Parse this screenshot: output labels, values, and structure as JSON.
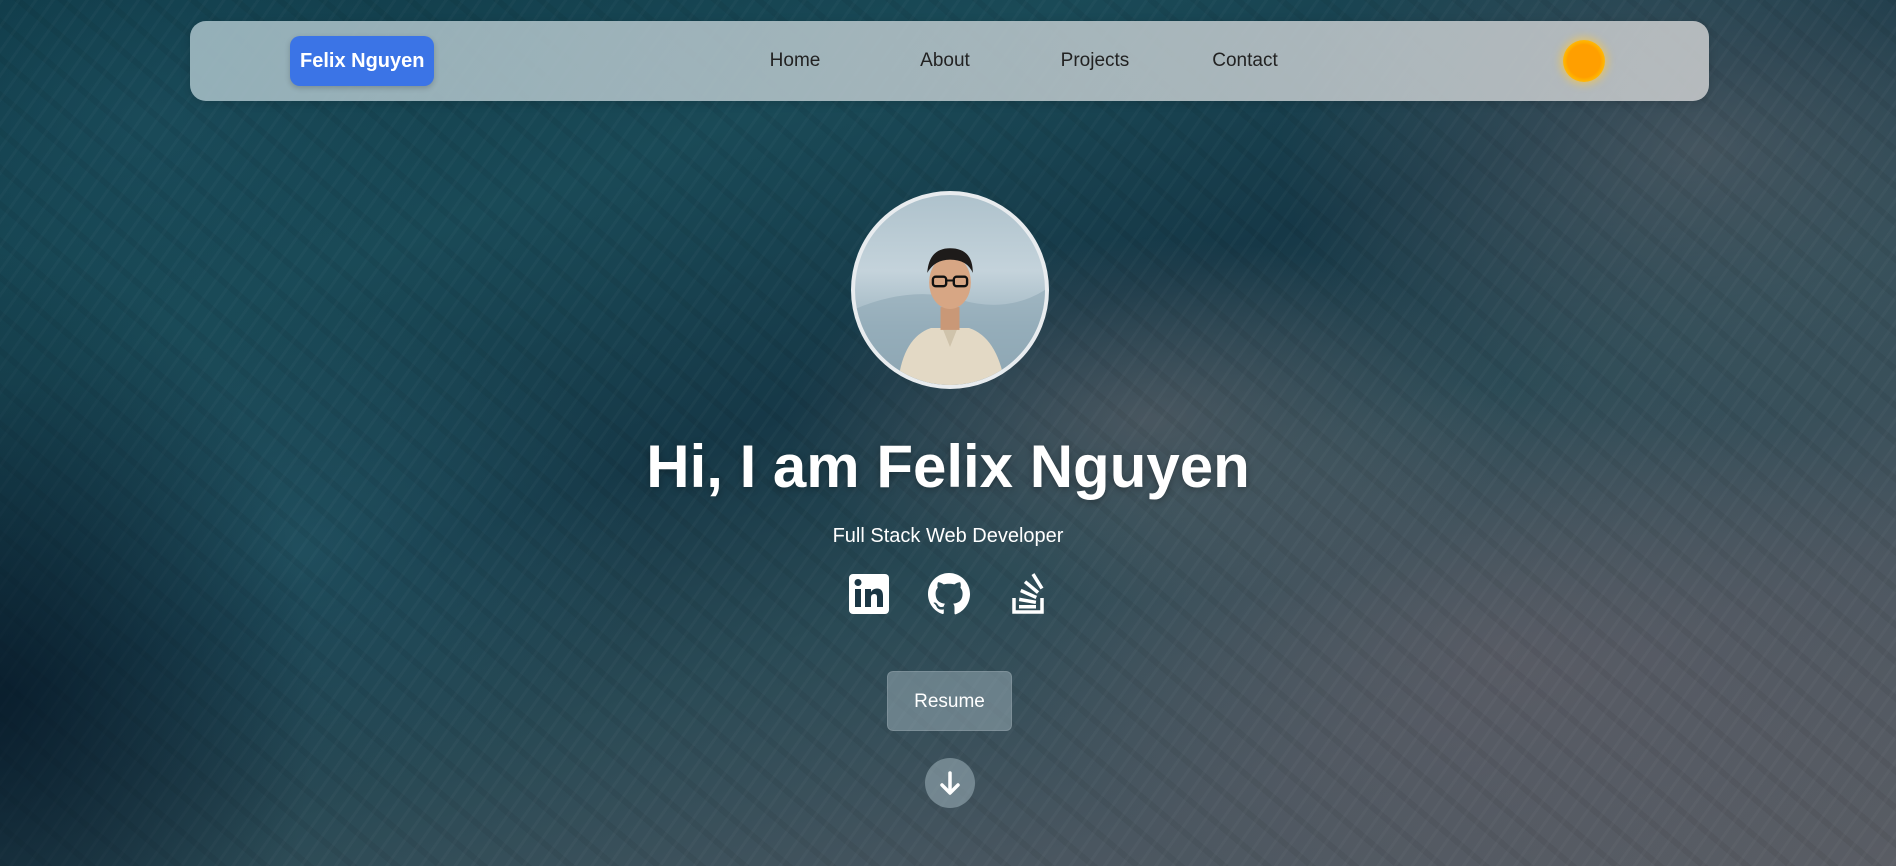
{
  "nav": {
    "brand": "Felix Nguyen",
    "links": [
      "Home",
      "About",
      "Projects",
      "Contact"
    ],
    "theme_icon": "sun-icon"
  },
  "hero": {
    "heading": "Hi, I am Felix Nguyen",
    "subtitle": "Full Stack Web Developer",
    "socials": [
      "linkedin-icon",
      "github-icon",
      "stackoverflow-icon"
    ],
    "resume_label": "Resume",
    "scroll_icon": "arrow-down-icon"
  },
  "colors": {
    "brand_button": "#3b74e6",
    "sun": "#ff9f00",
    "text": "#ffffff"
  }
}
